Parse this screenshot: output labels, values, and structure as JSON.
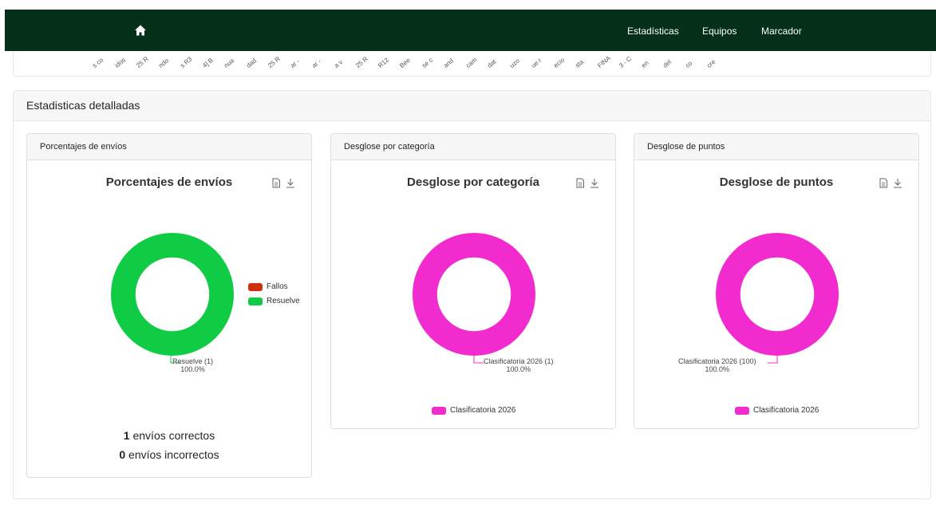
{
  "navbar": {
    "home_icon": "home-icon",
    "links": [
      "Estadísticas",
      "Equipos",
      "Marcador"
    ]
  },
  "top_chart": {
    "tick_labels": [
      "s co",
      "idos",
      "25 R",
      "ndo",
      "s R3",
      "4] B",
      "nua",
      "dad",
      "25 R",
      "ar -",
      "ar -",
      "a v",
      "25 R",
      "R12",
      "Bee",
      "se c",
      "and",
      "cam",
      "dat",
      "uzo",
      "ue r",
      "ecio",
      "sta",
      "FINA",
      "3 - C",
      "en",
      "del",
      "co",
      "cre"
    ]
  },
  "detail": {
    "title": "Estadisticas detalladas"
  },
  "chart_data": [
    {
      "type": "pie",
      "title": "Porcentajes de envíos",
      "categories": [
        "Fallos",
        "Resuelve"
      ],
      "values": [
        0,
        1
      ],
      "colors": [
        "#d32f0d",
        "#0fcc44"
      ],
      "data_label": {
        "name": "Resuelve (1)",
        "pct": "100.0%"
      },
      "legend": "right",
      "inner_radius_ratio": 0.6
    },
    {
      "type": "pie",
      "title": "Desglose por categoría",
      "categories": [
        "Clasificatoria 2026"
      ],
      "values": [
        1
      ],
      "colors": [
        "#f22bcf"
      ],
      "data_label": {
        "name": "Clasificatoria 2026 (1)",
        "pct": "100.0%"
      },
      "legend": "bottom",
      "inner_radius_ratio": 0.6
    },
    {
      "type": "pie",
      "title": "Desglose de puntos",
      "categories": [
        "Clasificatoria 2026"
      ],
      "values": [
        100
      ],
      "colors": [
        "#f22bcf"
      ],
      "data_label": {
        "name": "Clasificatoria 2026 (100)",
        "pct": "100.0%"
      },
      "legend": "bottom",
      "inner_radius_ratio": 0.6
    }
  ],
  "panels": [
    {
      "header": "Porcentajes de envíos"
    },
    {
      "header": "Desglose por categoría"
    },
    {
      "header": "Desglose de puntos"
    }
  ],
  "summary": {
    "correct_count": "1",
    "correct_text": " envíos correctos",
    "incorrect_count": "0",
    "incorrect_text": " envíos incorrectos"
  },
  "icons": {
    "download_data": "document-icon",
    "download_image": "download-icon"
  }
}
